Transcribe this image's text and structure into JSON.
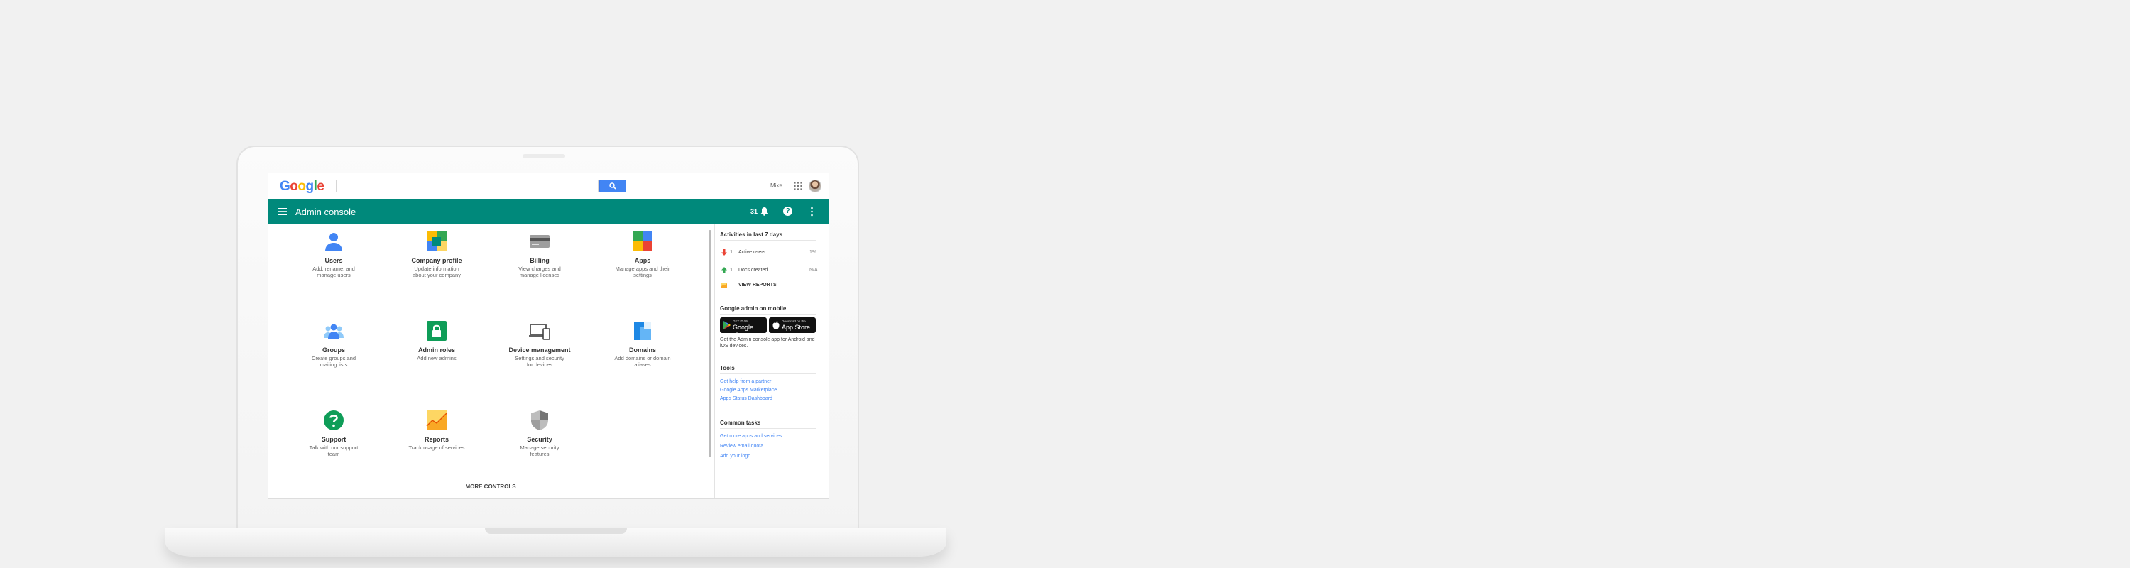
{
  "topbar": {
    "logo_letters": [
      {
        "ch": "G",
        "color": "#4285f4"
      },
      {
        "ch": "o",
        "color": "#ea4335"
      },
      {
        "ch": "o",
        "color": "#fbbc05"
      },
      {
        "ch": "g",
        "color": "#4285f4"
      },
      {
        "ch": "l",
        "color": "#34a853"
      },
      {
        "ch": "e",
        "color": "#ea4335"
      }
    ],
    "search_placeholder": "",
    "user_name": "Mike",
    "apps_icon": "apps-grid-icon",
    "avatar_icon": "avatar"
  },
  "header": {
    "menu_icon": "hamburger-menu-icon",
    "title": "Admin console",
    "notification_count": "31",
    "bell_icon": "bell-icon",
    "help_label": "?",
    "more_icon": "more-vert-icon",
    "accent_color": "#00897b"
  },
  "tiles": [
    {
      "title": "Users",
      "desc": "Add, rename, and manage users",
      "icon": "users-icon"
    },
    {
      "title": "Company profile",
      "desc": "Update information about your company",
      "icon": "company-profile-icon"
    },
    {
      "title": "Billing",
      "desc": "View charges and manage licenses",
      "icon": "billing-icon"
    },
    {
      "title": "Apps",
      "desc": "Manage apps and their settings",
      "icon": "apps-icon"
    },
    {
      "title": "Groups",
      "desc": "Create groups and mailing lists",
      "icon": "groups-icon"
    },
    {
      "title": "Admin roles",
      "desc": "Add new admins",
      "icon": "admin-roles-icon"
    },
    {
      "title": "Device management",
      "desc": "Settings and security for devices",
      "icon": "device-management-icon"
    },
    {
      "title": "Domains",
      "desc": "Add domains or domain aliases",
      "icon": "domains-icon"
    },
    {
      "title": "Support",
      "desc": "Talk with our support team",
      "icon": "support-icon"
    },
    {
      "title": "Reports",
      "desc": "Track usage of services",
      "icon": "reports-icon"
    },
    {
      "title": "Security",
      "desc": "Manage security features",
      "icon": "security-icon"
    }
  ],
  "more_controls": "MORE CONTROLS",
  "side": {
    "activities_heading": "Activities in last 7 days",
    "activities": [
      {
        "count": "1",
        "label": "Active users",
        "value": "1%",
        "icon": "arrow-down-icon",
        "color": "#ea4335"
      },
      {
        "count": "1",
        "label": "Docs created",
        "value": "N/A",
        "icon": "arrow-up-icon",
        "color": "#34a853"
      }
    ],
    "view_reports": "VIEW REPORTS",
    "mobile_heading": "Google admin on mobile",
    "google_play": {
      "small": "GET IT ON",
      "big": "Google play"
    },
    "app_store": {
      "small": "Download on the",
      "big": "App Store"
    },
    "mobile_text": "Get the Admin console app for Android and iOS devices.",
    "tools_heading": "Tools",
    "tools_links": [
      "Get help from a partner",
      "Google Apps Marketplace",
      "Apps Status Dashboard"
    ],
    "tasks_heading": "Common tasks",
    "tasks_links": [
      "Get more apps and services",
      "Review email quota",
      "Add your logo"
    ]
  }
}
